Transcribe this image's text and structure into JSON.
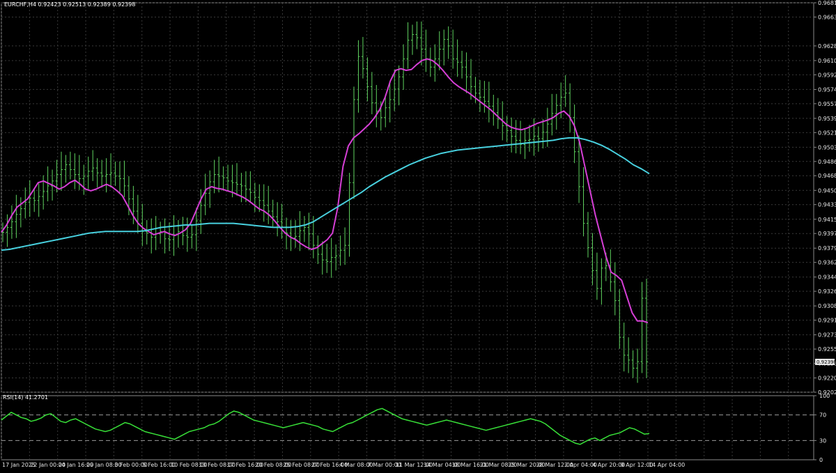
{
  "header": {
    "symbol_line": "EURCHF,H4  0.92423 0.92513 0.92389 0.92398"
  },
  "rsi_panel": {
    "label": "RSI(14) 41.2701"
  },
  "current_price_tag": "0.92398",
  "colors": {
    "background": "#000000",
    "grid": "#3a3a3a",
    "candles": "#5fd35f",
    "ma_fast": "#d63fd6",
    "ma_slow": "#48d1df",
    "rsi_line": "#38e038",
    "axis_text": "#e6e6e6",
    "price_tag_bg": "#e6e6e6"
  },
  "chart_data": [
    {
      "type": "line",
      "title": "EURCHF,H4",
      "ylim": [
        0.92025,
        0.9681
      ],
      "y_ticks": [
        "0.96810",
        "0.96635",
        "0.96280",
        "0.96100",
        "0.95925",
        "0.95745",
        "0.95570",
        "0.95390",
        "0.95215",
        "0.95035",
        "0.94860",
        "0.94685",
        "0.94505",
        "0.94330",
        "0.94150",
        "0.93975",
        "0.93795",
        "0.93620",
        "0.93440",
        "0.93265",
        "0.93085",
        "0.92910",
        "0.92730",
        "0.92555",
        "0.92380",
        "0.92200",
        "0.92025"
      ],
      "x_ticks": [
        "17 Jan 2025",
        "22 Jan 00:00",
        "24 Jan 16:00",
        "29 Jan 08:00",
        "3 Feb 00:00",
        "5 Feb 16:00",
        "10 Feb 08:00",
        "13 Feb 08:00",
        "17 Feb 16:00",
        "20 Feb 08:00",
        "25 Feb 08:00",
        "27 Feb 16:00",
        "4 Mar 08:00",
        "7 Mar 00:00",
        "11 Mar 12:00",
        "14 Mar 04:00",
        "18 Mar 16:00",
        "21 Mar 08:00",
        "25 Mar 20:00",
        "28 Mar 12:00",
        "2 Apr 04:00",
        "4 Apr 20:00",
        "9 Apr 12:00",
        "14 Apr 04:00"
      ],
      "close": [
        0.9399,
        0.9405,
        0.9412,
        0.9421,
        0.9428,
        0.9436,
        0.9441,
        0.9438,
        0.9443,
        0.9449,
        0.9456,
        0.9462,
        0.947,
        0.9476,
        0.9482,
        0.9476,
        0.947,
        0.9465,
        0.9468,
        0.9474,
        0.9478,
        0.9472,
        0.9468,
        0.947,
        0.9472,
        0.9468,
        0.9465,
        0.9456,
        0.944,
        0.9425,
        0.941,
        0.94,
        0.9398,
        0.9393,
        0.9397,
        0.94,
        0.9391,
        0.939,
        0.9396,
        0.94,
        0.9395,
        0.9393,
        0.9396,
        0.9413,
        0.9432,
        0.9447,
        0.9461,
        0.947,
        0.9468,
        0.9466,
        0.9462,
        0.946,
        0.9458,
        0.9456,
        0.9452,
        0.9448,
        0.9442,
        0.9438,
        0.9432,
        0.9425,
        0.9418,
        0.9412,
        0.9405,
        0.9398,
        0.9392,
        0.9394,
        0.9401,
        0.9405,
        0.9397,
        0.9383,
        0.9372,
        0.9365,
        0.9363,
        0.9368,
        0.937,
        0.9377,
        0.9383,
        0.946,
        0.9562,
        0.9615,
        0.96,
        0.9578,
        0.9558,
        0.9548,
        0.954,
        0.9552,
        0.9562,
        0.9575,
        0.959,
        0.9612,
        0.9635,
        0.9642,
        0.9638,
        0.9624,
        0.9612,
        0.9602,
        0.9612,
        0.9624,
        0.9636,
        0.9628,
        0.9612,
        0.9608,
        0.9602,
        0.959,
        0.9578,
        0.957,
        0.9565,
        0.956,
        0.9554,
        0.9546,
        0.9538,
        0.953,
        0.9524,
        0.9517,
        0.9512,
        0.9507,
        0.9512,
        0.9513,
        0.9517,
        0.9514,
        0.9522,
        0.9532,
        0.9545,
        0.9555,
        0.9565,
        0.957,
        0.954,
        0.9498,
        0.9455,
        0.941,
        0.938,
        0.9352,
        0.933,
        0.9355,
        0.9358,
        0.9338,
        0.9315,
        0.927,
        0.9248,
        0.9242,
        0.9232,
        0.924,
        0.9318,
        0.924
      ],
      "series": [
        {
          "name": "",
          "values": [
            0.9399,
            0.9408,
            0.942,
            0.943,
            0.9435,
            0.944,
            0.945,
            0.946,
            0.9462,
            0.9459,
            0.9456,
            0.9452,
            0.9455,
            0.946,
            0.9463,
            0.9458,
            0.9452,
            0.945,
            0.9452,
            0.9455,
            0.9458,
            0.9455,
            0.945,
            0.9444,
            0.9432,
            0.942,
            0.941,
            0.9404,
            0.94,
            0.9396,
            0.9398,
            0.94,
            0.9397,
            0.9395,
            0.9398,
            0.9402,
            0.941,
            0.9425,
            0.944,
            0.9452,
            0.9455,
            0.9453,
            0.9452,
            0.945,
            0.9448,
            0.9445,
            0.9442,
            0.9438,
            0.9433,
            0.9428,
            0.9425,
            0.942,
            0.9413,
            0.9405,
            0.9398,
            0.9393,
            0.939,
            0.9385,
            0.9381,
            0.9378,
            0.938,
            0.9385,
            0.939,
            0.9398,
            0.943,
            0.948,
            0.9505,
            0.9515,
            0.952,
            0.9526,
            0.9532,
            0.954,
            0.955,
            0.9565,
            0.9585,
            0.9598,
            0.96,
            0.9598,
            0.9599,
            0.9605,
            0.961,
            0.9612,
            0.961,
            0.9605,
            0.9598,
            0.959,
            0.9583,
            0.9578,
            0.9574,
            0.957,
            0.9565,
            0.956,
            0.9555,
            0.955,
            0.9544,
            0.9538,
            0.9532,
            0.9528,
            0.9526,
            0.9525,
            0.9527,
            0.953,
            0.9533,
            0.9535,
            0.9537,
            0.954,
            0.9545,
            0.9548,
            0.9542,
            0.953,
            0.951,
            0.948,
            0.945,
            0.942,
            0.9395,
            0.937,
            0.935,
            0.9346,
            0.934,
            0.932,
            0.93,
            0.929,
            0.929,
            0.9288
          ]
        },
        {
          "name": "",
          "values": [
            0.9377,
            0.9378,
            0.938,
            0.9382,
            0.9384,
            0.9386,
            0.9388,
            0.939,
            0.9392,
            0.9394,
            0.9396,
            0.9398,
            0.9399,
            0.94,
            0.94,
            0.94,
            0.94,
            0.94,
            0.9401,
            0.9403,
            0.9405,
            0.9406,
            0.9407,
            0.9408,
            0.9408,
            0.9409,
            0.941,
            0.941,
            0.941,
            0.941,
            0.9409,
            0.9408,
            0.9407,
            0.9406,
            0.9405,
            0.9405,
            0.9405,
            0.9406,
            0.9408,
            0.9412,
            0.9418,
            0.9424,
            0.943,
            0.9436,
            0.9442,
            0.9448,
            0.9455,
            0.9461,
            0.9467,
            0.9472,
            0.9477,
            0.9482,
            0.9486,
            0.949,
            0.9493,
            0.9496,
            0.9498,
            0.95,
            0.9501,
            0.9502,
            0.9503,
            0.9504,
            0.9505,
            0.9506,
            0.9507,
            0.9508,
            0.9509,
            0.951,
            0.9511,
            0.9512,
            0.9514,
            0.9515,
            0.9515,
            0.9513,
            0.951,
            0.9506,
            0.9501,
            0.9495,
            0.9489,
            0.9482,
            0.9477,
            0.9471
          ]
        }
      ]
    },
    {
      "type": "line",
      "title": "RSI(14) 41.2701",
      "ylim": [
        0,
        100
      ],
      "y_ticks": [
        "100",
        "70",
        "30",
        "0"
      ],
      "levels": [
        70,
        30
      ],
      "series": [
        {
          "name": "",
          "values": [
            62,
            68,
            74,
            70,
            66,
            64,
            60,
            62,
            65,
            70,
            72,
            66,
            60,
            58,
            62,
            64,
            60,
            56,
            52,
            48,
            46,
            44,
            46,
            50,
            54,
            58,
            56,
            52,
            48,
            44,
            42,
            40,
            38,
            36,
            34,
            32,
            36,
            40,
            44,
            46,
            48,
            50,
            54,
            56,
            60,
            66,
            72,
            76,
            74,
            70,
            66,
            62,
            60,
            58,
            56,
            54,
            52,
            50,
            52,
            54,
            56,
            58,
            56,
            54,
            52,
            48,
            46,
            44,
            48,
            52,
            56,
            58,
            62,
            66,
            70,
            74,
            78,
            80,
            76,
            72,
            68,
            64,
            62,
            60,
            58,
            56,
            54,
            56,
            58,
            60,
            62,
            60,
            58,
            56,
            54,
            52,
            50,
            48,
            46,
            48,
            50,
            52,
            54,
            56,
            58,
            60,
            62,
            64,
            62,
            60,
            56,
            50,
            44,
            38,
            34,
            30,
            26,
            24,
            28,
            32,
            34,
            30,
            34,
            38,
            40,
            42,
            46,
            50,
            48,
            44,
            40,
            41
          ]
        }
      ]
    }
  ]
}
